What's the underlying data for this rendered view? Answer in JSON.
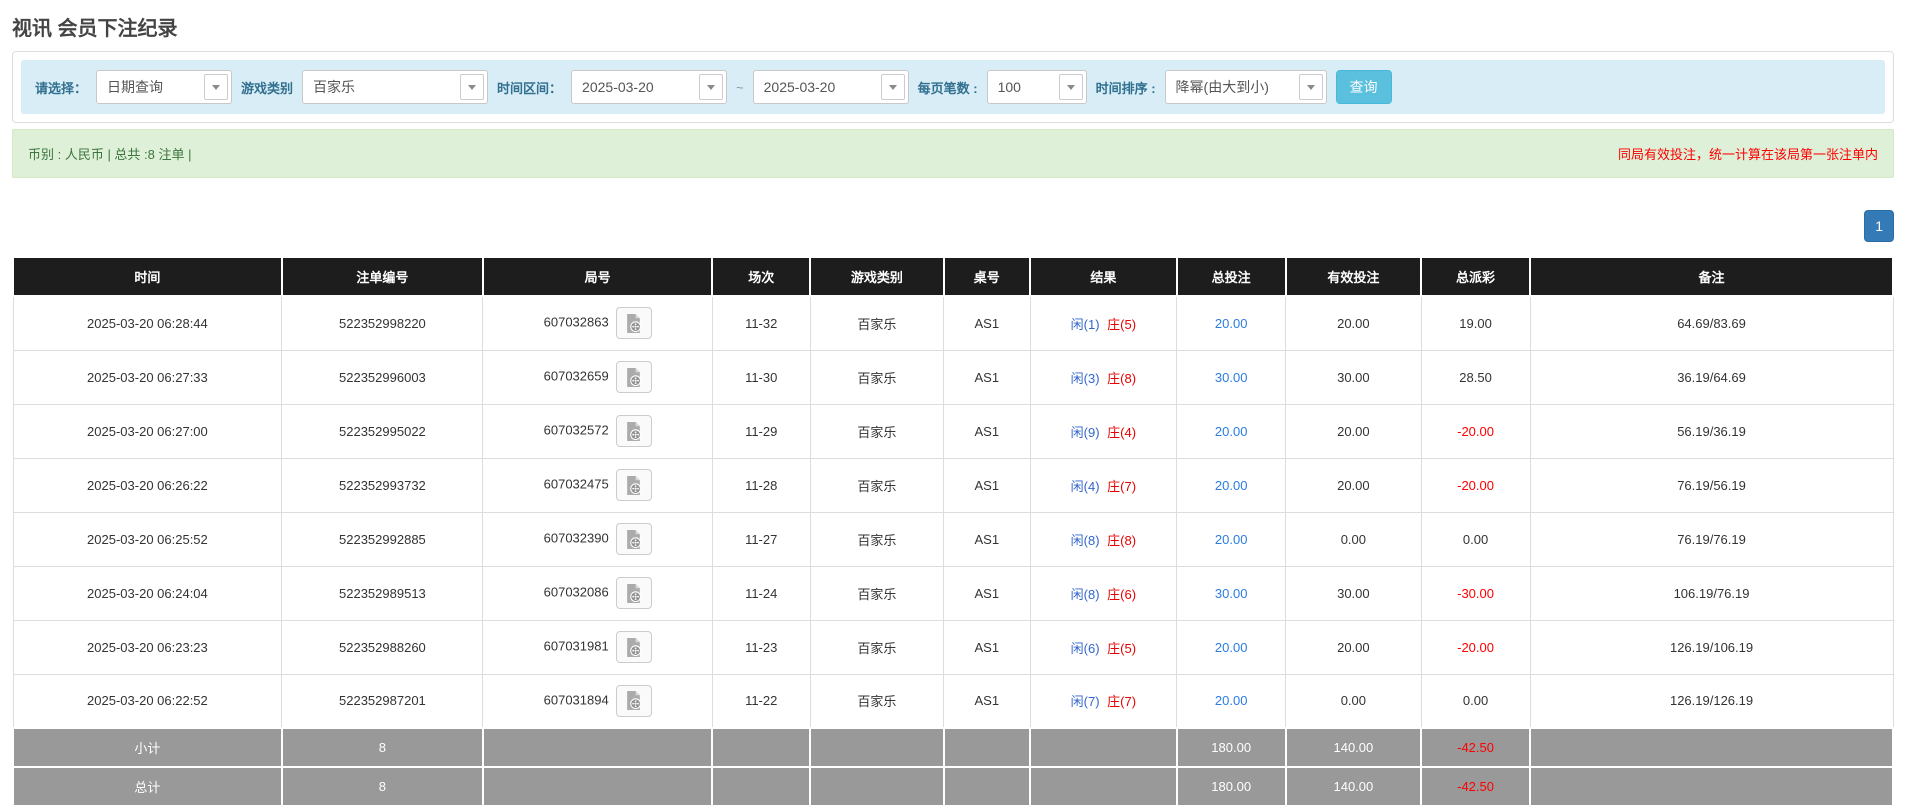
{
  "page": {
    "title": "视讯 会员下注纪录"
  },
  "filters": {
    "query_type": {
      "label": "请选择：",
      "value": "日期查询"
    },
    "game_type": {
      "label": "游戏类别",
      "value": "百家乐"
    },
    "date_range": {
      "label": "时间区间：",
      "from": "2025-03-20",
      "separator": "~",
      "to": "2025-03-20"
    },
    "page_size": {
      "label": "每页笔数 :",
      "value": "100"
    },
    "sort": {
      "label": "时间排序 :",
      "value": "降幂(由大到小)"
    },
    "search_button_label": "查询"
  },
  "summary_bar": {
    "left_text": "币别 : 人民币 | 总共 :8 注单 |",
    "right_note": "同局有效投注，统一计算在该局第一张注单内"
  },
  "pagination": {
    "current_page": "1"
  },
  "icons": {
    "dropdown_arrow": "chevron-down-icon",
    "round_video": "video-clip-icon"
  },
  "colors": {
    "filter_bar_bg": "#d9edf7",
    "filter_label": "#31708f",
    "search_button_bg": "#5bc0de",
    "alert_bg": "#dff0d8",
    "alert_text_green": "#3c763d",
    "alert_note_red": "#ff0000",
    "table_header_bg": "#1d1d1d",
    "summary_row_bg": "#999999",
    "amount_link_blue": "#2b7de0",
    "player_blue": "#3366cc",
    "banker_red": "#e60000",
    "negative_red": "#ff0000",
    "pagination_bg": "#337ab7"
  },
  "table": {
    "headers": [
      "时间",
      "注单编号",
      "局号",
      "场次",
      "游戏类别",
      "桌号",
      "结果",
      "总投注",
      "有效投注",
      "总派彩",
      "备注"
    ],
    "rows": [
      {
        "time": "2025-03-20 06:28:44",
        "bet_id": "522352998220",
        "round_id": "607032863",
        "session": "11-32",
        "game": "百家乐",
        "table_no": "AS1",
        "result_player": "闲(1)",
        "result_banker": "庄(5)",
        "total_bet": "20.00",
        "valid_bet": "20.00",
        "payout": "19.00",
        "remark": "64.69/83.69"
      },
      {
        "time": "2025-03-20 06:27:33",
        "bet_id": "522352996003",
        "round_id": "607032659",
        "session": "11-30",
        "game": "百家乐",
        "table_no": "AS1",
        "result_player": "闲(3)",
        "result_banker": "庄(8)",
        "total_bet": "30.00",
        "valid_bet": "30.00",
        "payout": "28.50",
        "remark": "36.19/64.69"
      },
      {
        "time": "2025-03-20 06:27:00",
        "bet_id": "522352995022",
        "round_id": "607032572",
        "session": "11-29",
        "game": "百家乐",
        "table_no": "AS1",
        "result_player": "闲(9)",
        "result_banker": "庄(4)",
        "total_bet": "20.00",
        "valid_bet": "20.00",
        "payout": "-20.00",
        "remark": "56.19/36.19"
      },
      {
        "time": "2025-03-20 06:26:22",
        "bet_id": "522352993732",
        "round_id": "607032475",
        "session": "11-28",
        "game": "百家乐",
        "table_no": "AS1",
        "result_player": "闲(4)",
        "result_banker": "庄(7)",
        "total_bet": "20.00",
        "valid_bet": "20.00",
        "payout": "-20.00",
        "remark": "76.19/56.19"
      },
      {
        "time": "2025-03-20 06:25:52",
        "bet_id": "522352992885",
        "round_id": "607032390",
        "session": "11-27",
        "game": "百家乐",
        "table_no": "AS1",
        "result_player": "闲(8)",
        "result_banker": "庄(8)",
        "total_bet": "20.00",
        "valid_bet": "0.00",
        "payout": "0.00",
        "remark": "76.19/76.19"
      },
      {
        "time": "2025-03-20 06:24:04",
        "bet_id": "522352989513",
        "round_id": "607032086",
        "session": "11-24",
        "game": "百家乐",
        "table_no": "AS1",
        "result_player": "闲(8)",
        "result_banker": "庄(6)",
        "total_bet": "30.00",
        "valid_bet": "30.00",
        "payout": "-30.00",
        "remark": "106.19/76.19"
      },
      {
        "time": "2025-03-20 06:23:23",
        "bet_id": "522352988260",
        "round_id": "607031981",
        "session": "11-23",
        "game": "百家乐",
        "table_no": "AS1",
        "result_player": "闲(6)",
        "result_banker": "庄(5)",
        "total_bet": "20.00",
        "valid_bet": "20.00",
        "payout": "-20.00",
        "remark": "126.19/106.19"
      },
      {
        "time": "2025-03-20 06:22:52",
        "bet_id": "522352987201",
        "round_id": "607031894",
        "session": "11-22",
        "game": "百家乐",
        "table_no": "AS1",
        "result_player": "闲(7)",
        "result_banker": "庄(7)",
        "total_bet": "20.00",
        "valid_bet": "0.00",
        "payout": "0.00",
        "remark": "126.19/126.19"
      }
    ],
    "subtotal": {
      "label": "小计",
      "count": "8",
      "total_bet": "180.00",
      "valid_bet": "140.00",
      "payout": "-42.50"
    },
    "total": {
      "label": "总计",
      "count": "8",
      "total_bet": "180.00",
      "valid_bet": "140.00",
      "payout": "-42.50"
    }
  }
}
